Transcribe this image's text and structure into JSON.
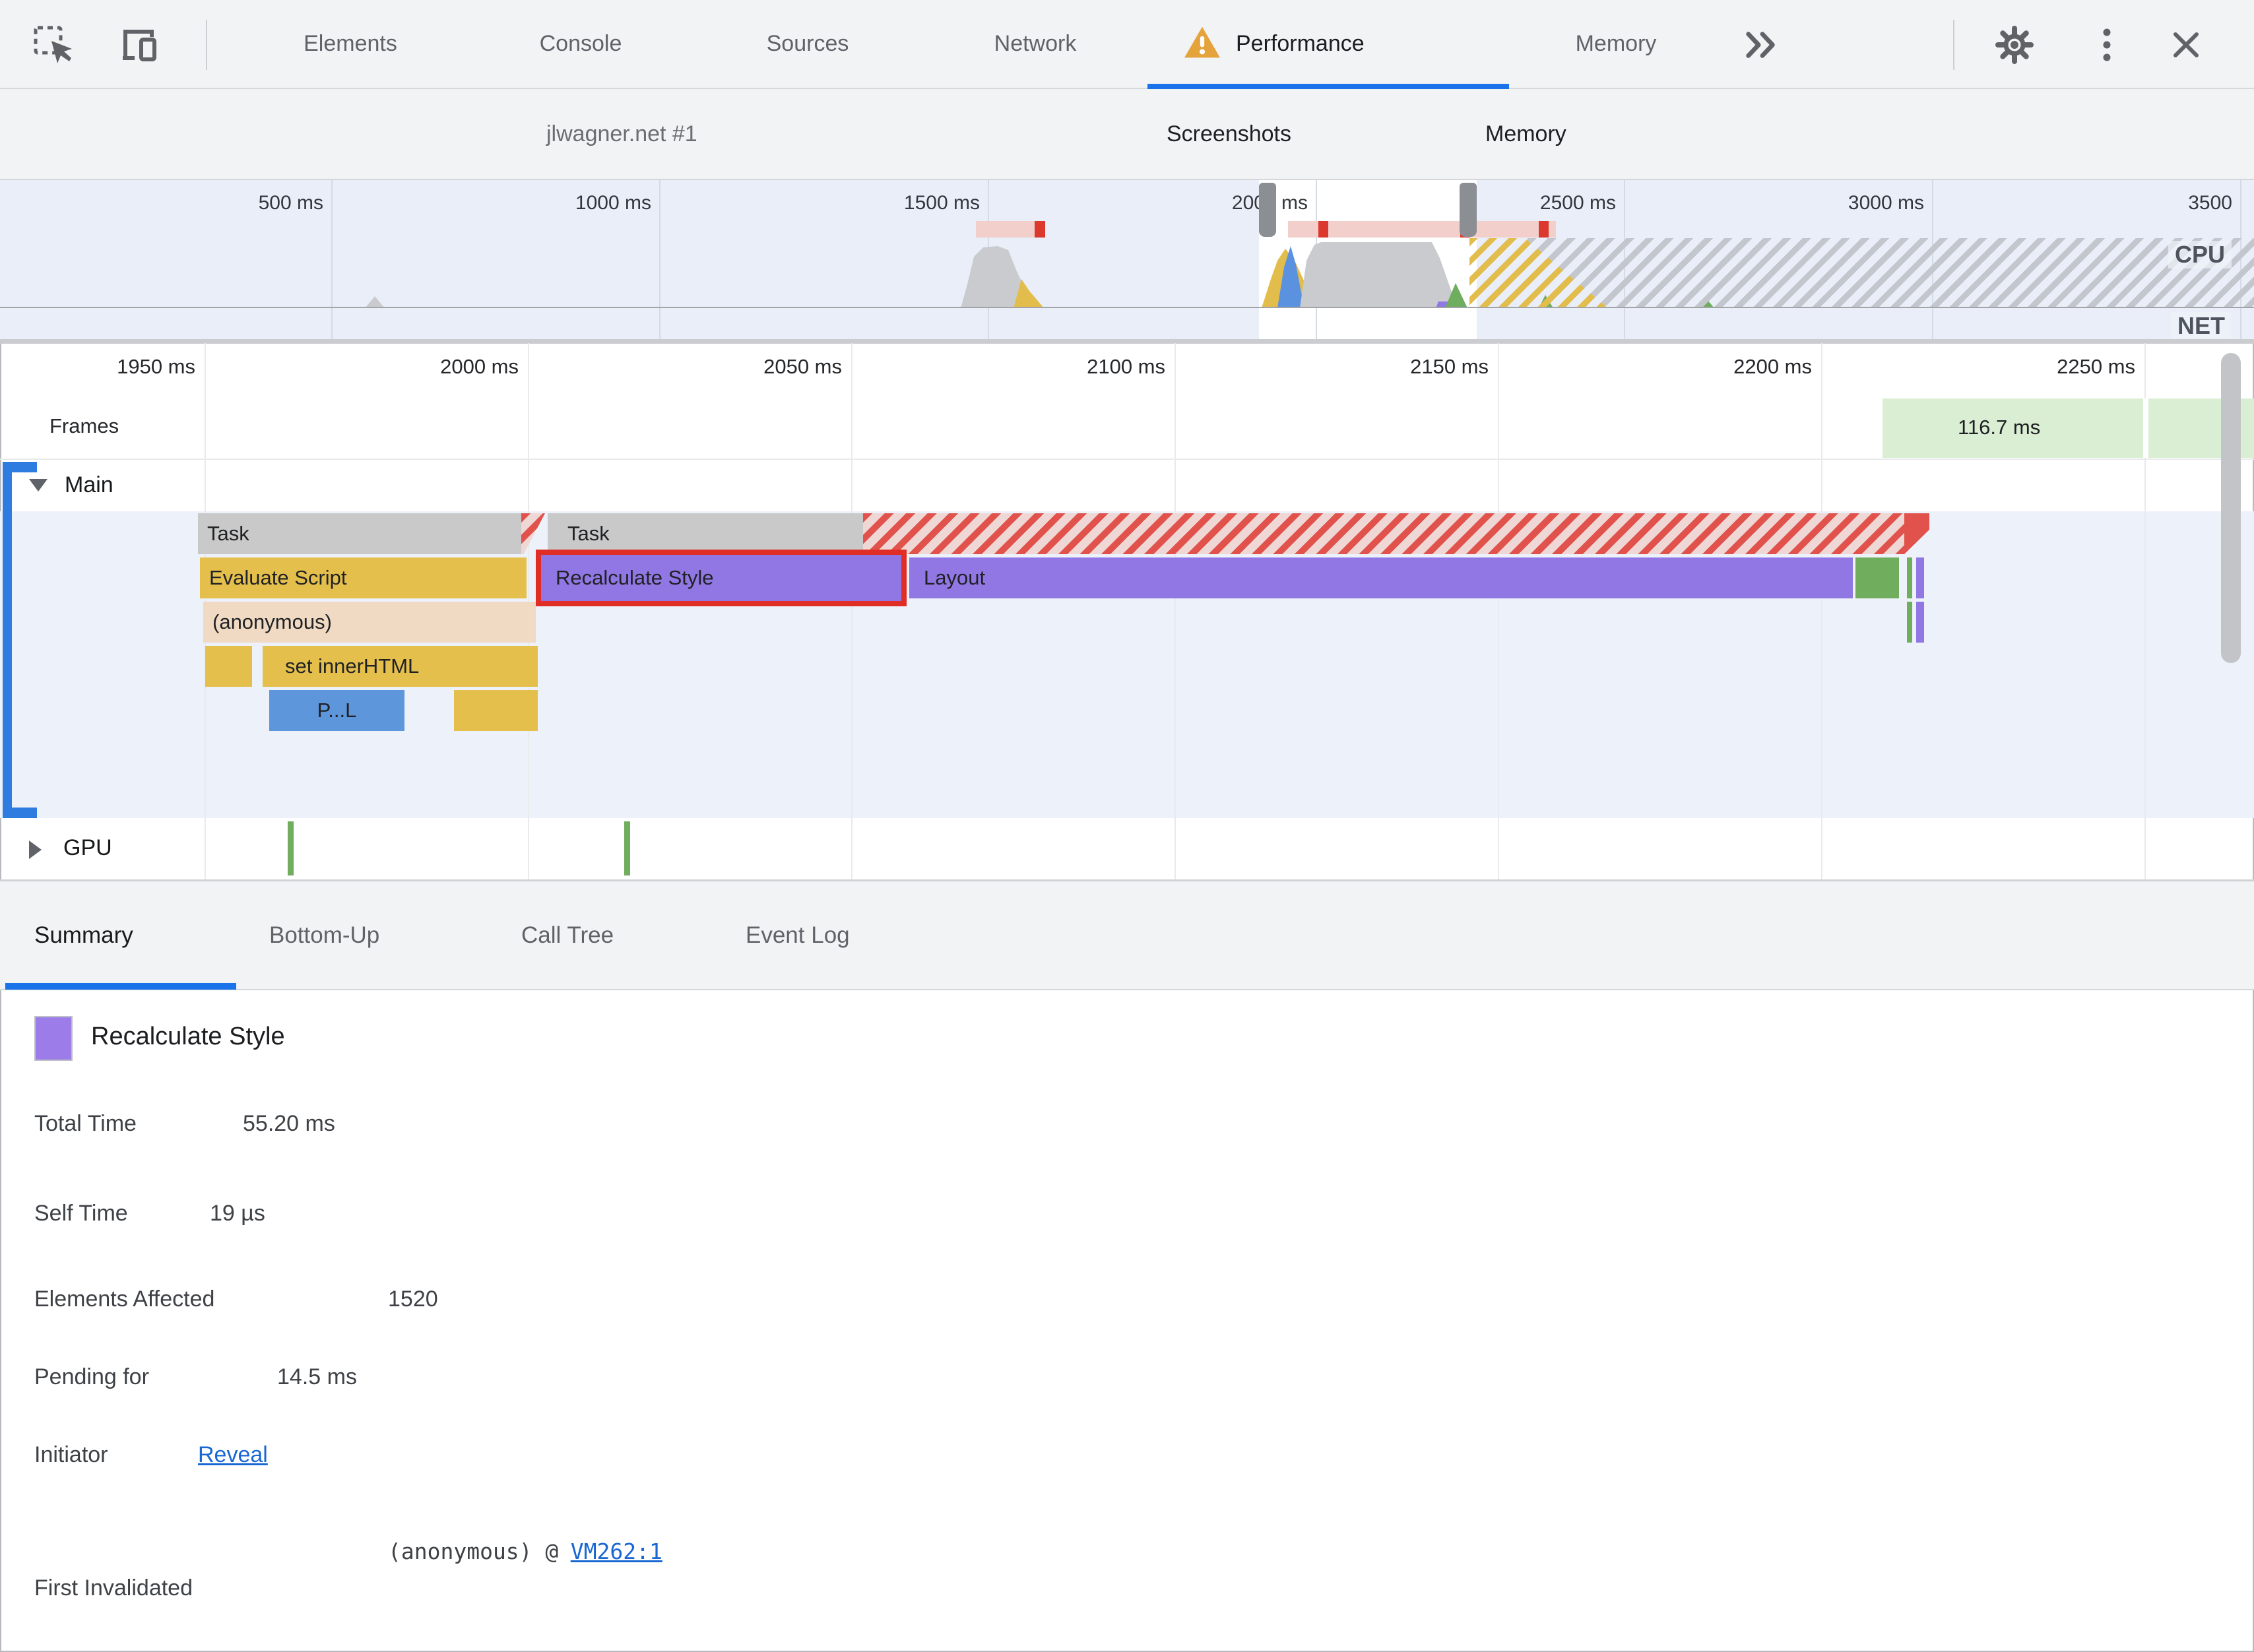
{
  "top_tabs": {
    "items": [
      "Elements",
      "Console",
      "Sources",
      "Network",
      "Performance",
      "Memory"
    ],
    "active": "Performance",
    "overflow_chevron": "»"
  },
  "toolbar": {
    "session_label": "jlwagner.net #1",
    "screenshots_label": "Screenshots",
    "memory_label": "Memory"
  },
  "overview": {
    "ticks": [
      "500 ms",
      "1000 ms",
      "1500 ms",
      "2000 ms",
      "2500 ms",
      "3000 ms",
      "3500"
    ],
    "cpu_label": "CPU",
    "net_label": "NET"
  },
  "ruler": {
    "ticks": [
      "1950 ms",
      "2000 ms",
      "2050 ms",
      "2100 ms",
      "2150 ms",
      "2200 ms",
      "2250 ms"
    ]
  },
  "frames": {
    "label": "Frames",
    "badge": "116.7 ms"
  },
  "tracks": {
    "main_label": "Main",
    "gpu_label": "GPU"
  },
  "flame": {
    "task1": "Task",
    "task2": "Task",
    "evaluate": "Evaluate Script",
    "recalc": "Recalculate Style",
    "layout": "Layout",
    "anonymous": "(anonymous)",
    "set_inner": "set innerHTML",
    "parse": "P...L"
  },
  "bottom_tabs": {
    "items": [
      "Summary",
      "Bottom-Up",
      "Call Tree",
      "Event Log"
    ],
    "active": "Summary"
  },
  "summary": {
    "title": "Recalculate Style",
    "rows": [
      {
        "label": "Total Time",
        "value": "55.20 ms"
      },
      {
        "label": "Self Time",
        "value": "19 µs"
      },
      {
        "label": "Elements Affected",
        "value": "1520"
      },
      {
        "label": "Pending for",
        "value": "14.5 ms"
      }
    ],
    "initiator_label": "Initiator",
    "initiator_link": "Reveal",
    "first_invalidated_label": "First Invalidated",
    "stack_text": "(anonymous) @",
    "stack_link": "VM262:1"
  },
  "colors": {
    "accent_blue": "#1a73e8",
    "selection_red": "#e02e27",
    "task_gray": "#c9c9c9",
    "scripting_yellow": "#e5bf4c",
    "rendering_purple": "#9077e3",
    "painting_green": "#70ad5c",
    "loading_blue": "#5e96dc",
    "function_tan": "#f0dac4",
    "frame_green": "#daeed4",
    "warning_orange": "#e5a33c",
    "record_gear_red": "#e03a2f"
  }
}
